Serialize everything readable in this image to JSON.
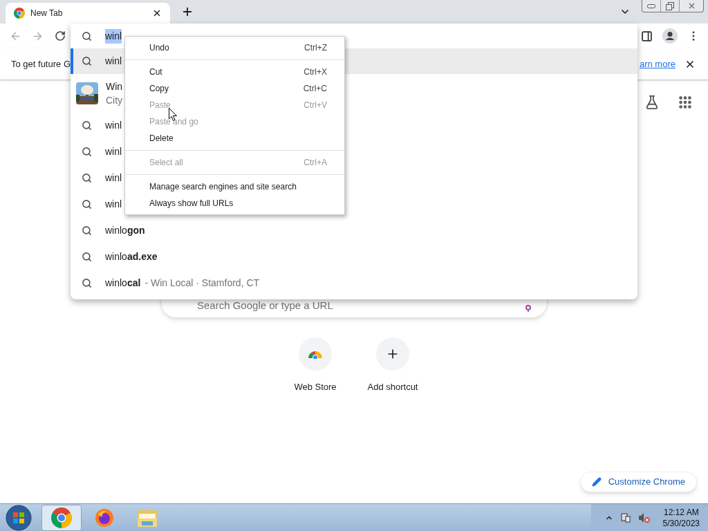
{
  "tabs": [
    {
      "title": "New Tab",
      "selected": true
    }
  ],
  "omnibox": {
    "value": "winl",
    "text_selected": true
  },
  "infobar": {
    "text": "To get future G",
    "link": "arn more"
  },
  "suggestions": [
    {
      "kind": "search",
      "text": "winl",
      "selected": true
    },
    {
      "kind": "entity",
      "title": "Win",
      "subtitle": "City",
      "selected": false
    },
    {
      "kind": "search",
      "text": "winl",
      "selected": false
    },
    {
      "kind": "search",
      "text": "winl",
      "selected": false
    },
    {
      "kind": "search",
      "text": "winl",
      "selected": false
    },
    {
      "kind": "search",
      "text": "winl",
      "selected": false
    },
    {
      "kind": "search",
      "text": "winlo**gon**",
      "selected": false
    },
    {
      "kind": "search",
      "text": "winlo**ad.exe**",
      "selected": false
    },
    {
      "kind": "search",
      "text": "winlo**cal**",
      "detail": "- Win Local · Stamford, CT",
      "selected": false
    }
  ],
  "context_menu": {
    "groups": [
      [
        {
          "label": "Undo",
          "shortcut": "Ctrl+Z",
          "disabled": false
        }
      ],
      [
        {
          "label": "Cut",
          "shortcut": "Ctrl+X",
          "disabled": false
        },
        {
          "label": "Copy",
          "shortcut": "Ctrl+C",
          "disabled": false
        },
        {
          "label": "Paste",
          "shortcut": "Ctrl+V",
          "disabled": true
        },
        {
          "label": "Paste and go",
          "disabled": true
        },
        {
          "label": "Delete",
          "disabled": false
        }
      ],
      [
        {
          "label": "Select all",
          "shortcut": "Ctrl+A",
          "disabled": true
        }
      ],
      [
        {
          "label": "Manage search engines and site search",
          "disabled": false
        },
        {
          "label": "Always show full URLs",
          "disabled": false
        }
      ]
    ]
  },
  "new_tab_page": {
    "search_placeholder": "Search Google or type a URL",
    "shortcuts": [
      {
        "kind": "webstore",
        "label": "Web Store"
      },
      {
        "kind": "add",
        "label": "Add shortcut"
      }
    ],
    "customize_button": "Customize Chrome"
  },
  "taskbar": {
    "apps": [
      {
        "kind": "chrome",
        "selected": true
      },
      {
        "kind": "firefox",
        "selected": false
      },
      {
        "kind": "explorer",
        "selected": false
      }
    ],
    "clock": {
      "time": "12:12 AM",
      "date": "5/30/2023"
    }
  }
}
